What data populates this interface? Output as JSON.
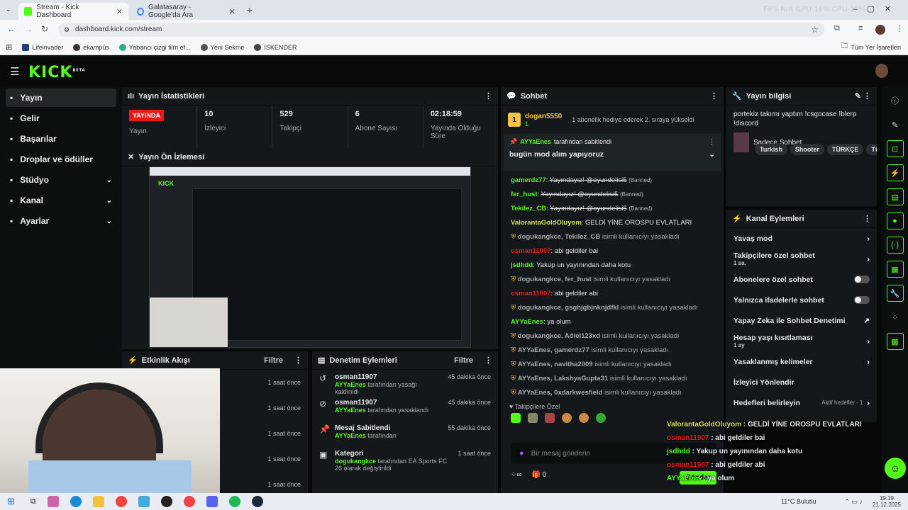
{
  "browser": {
    "tabs": [
      {
        "label": "Stream - Kick Dashboard",
        "active": true
      },
      {
        "label": "Galatasaray - Google'da Ara",
        "active": false
      }
    ],
    "perf": "FPS N/A   GPU 16%   CPU 19%",
    "url": "dashboard.kick.com/stream",
    "bookmarks": [
      "Lifeinvader",
      "ekampüs",
      "Yabancı çizgi film ef...",
      "Yeni Sekme",
      "İSKENDER"
    ],
    "all_bookmarks": "Tüm Yer İşaretleri"
  },
  "app": {
    "logo": "KICK",
    "logo_beta": "BETA",
    "sidebar": [
      {
        "label": "Yayın",
        "icon": "stream-icon",
        "active": true
      },
      {
        "label": "Gelir",
        "icon": "revenue-icon"
      },
      {
        "label": "Başarılar",
        "icon": "trophy-icon"
      },
      {
        "label": "Droplar ve ödüller",
        "icon": "gift-icon"
      },
      {
        "label": "Stüdyo",
        "icon": "studio-icon",
        "chevron": true
      },
      {
        "label": "Kanal",
        "icon": "channel-icon",
        "chevron": true
      },
      {
        "label": "Ayarlar",
        "icon": "gear-icon",
        "chevron": true
      }
    ]
  },
  "stats": {
    "title": "Yayın İstatistikleri",
    "items": [
      {
        "value": "YAYINDA",
        "label": "Yayın"
      },
      {
        "value": "10",
        "label": "İzleyici"
      },
      {
        "value": "529",
        "label": "Takipçi"
      },
      {
        "value": "6",
        "label": "Abone Sayısı"
      },
      {
        "value": "02:18:59",
        "label": "Yayında Olduğu Süre"
      }
    ]
  },
  "preview": {
    "title": "Yayın Ön İzlemesi"
  },
  "activity": {
    "title": "Etkinlik Akışı",
    "filter": "Filtre",
    "times": [
      "1 saat önce",
      "1 saat önce",
      "1 saat önce",
      "1 saat önce",
      "1 saat önce"
    ]
  },
  "moderation": {
    "title": "Denetim Eylemleri",
    "filter": "Filtre",
    "rows": [
      {
        "icon": "undo-icon",
        "title": "osman11907",
        "by": "AYYaEnes",
        "rest": "tarafından yasağı kaldırıldı",
        "time": "45 dakika önce"
      },
      {
        "icon": "ban-icon",
        "title": "osman11907",
        "by": "AYYaEnes",
        "rest": "tarafından yasaklandı",
        "time": "45 dakika önce"
      },
      {
        "icon": "pin-icon",
        "title": "Mesaj Sabitlendi",
        "by": "AYYaEnes",
        "rest": "tarafından",
        "time": "55 dakika önce"
      },
      {
        "icon": "category-icon",
        "title": "Kategori",
        "by": "dogukangkce",
        "rest": "tarafından EA Sports FC 26 olarak değiştirildi",
        "time": "1 saat önce"
      }
    ]
  },
  "chat": {
    "title": "Sohbet",
    "gifter": {
      "name": "dogan5550",
      "count": "1",
      "text": "1 abonelik hediye ederek 2. sıraya yükseldi"
    },
    "pinned": {
      "by": "AYYaEnes",
      "label": "tarafından sabitlendi",
      "text": "bugün mod alım yapıyoruz"
    },
    "messages": [
      {
        "user": "gamerdz77",
        "color": "#53fc18",
        "text": "Yayındayız! @oyundelisi5",
        "banned": "(Banned)"
      },
      {
        "user": "fer_hust",
        "color": "#53fc18",
        "text": "Yayındayız! @oyundelisi5",
        "banned": "(Banned)"
      },
      {
        "user": "Tekilez_CB",
        "color": "#53fc18",
        "text": "Yayındayız! @oyundelisi5",
        "banned": "(Banned)"
      },
      {
        "user": "ValorantaGoldOluyom",
        "color": "#d4e157",
        "text": "GELDİ YİNE OROSPU EVLATLARI"
      },
      {
        "sys": "dogukangkce, Tekilez_CB",
        "systext": "isimli kullanıcıyı yasakladı"
      },
      {
        "user": "osman11907",
        "color": "#e91916",
        "text": "abi geldiler bai"
      },
      {
        "user": "jsdhdd",
        "color": "#53fc18",
        "text": "Yakup un yayınından daha kotu"
      },
      {
        "sys": "dogukangkce, fer_hust",
        "systext": "isimli kullanıcıyı yasakladı"
      },
      {
        "user": "osman11907",
        "color": "#e91916",
        "text": "abi geldiler abi"
      },
      {
        "sys": "dogukangkce, gsghjgbjnknjdfkl",
        "systext": "isimli kullanıcıyı yasakladı"
      },
      {
        "user": "AYYaEnes",
        "color": "#53fc18",
        "text": "ya olum"
      },
      {
        "sys": "dogukangkce, Adiel123xd",
        "systext": "isimli kullanıcıyı yasakladı"
      },
      {
        "sys": "AYYaEnes, gamerdz77",
        "systext": "isimli kullanıcıyı yasakladı"
      },
      {
        "sys": "AYYaEnes, navitha2009",
        "systext": "isimli kullanıcıyı yasakladı"
      },
      {
        "sys": "AYYaEnes, LakshyaGupta31",
        "systext": "isimli kullanıcıyı yasakladı"
      },
      {
        "sys": "AYYaEnes, 0xdarkwesfield",
        "systext": "isimli kullanıcıyı yasakladı"
      }
    ],
    "followers_only": "Takipçilere Özel",
    "input_placeholder": "Bir mesaj gönderin",
    "points": "0",
    "send": "Gönder"
  },
  "overlay_chat": [
    {
      "user": "ValorantaGoldOluyom",
      "color": "#d4e157",
      "text": "GELDİ YİNE OROSPU EVLATLARI"
    },
    {
      "user": "osman11907",
      "color": "#e91916",
      "text": "abi geldiler bai"
    },
    {
      "user": "jsdhdd",
      "color": "#53fc18",
      "text": "Yakup un yayınından daha kotu"
    },
    {
      "user": "osman11907",
      "color": "#e91916",
      "text": "abi geldiler abi"
    },
    {
      "user": "AYYaEnes",
      "color": "#53fc18",
      "text": "ya olum"
    }
  ],
  "info": {
    "title": "Yayın bilgisi",
    "stream_title": "portekiz takımı yaptım !csgocase !blerp !discord",
    "category": "Sadece Sohbet",
    "tags": [
      "Turkish",
      "Shooter",
      "TÜRKÇE",
      "Türk"
    ]
  },
  "channel": {
    "title": "Kanal Eylemleri",
    "rows": [
      {
        "label": "Yavaş mod",
        "type": "chev"
      },
      {
        "label": "Takipçilere özel sohbet",
        "sub": "1 sa.",
        "type": "chev"
      },
      {
        "label": "Abonelere özel sohbet",
        "type": "toggle"
      },
      {
        "label": "Yalnızca ifadelerle sohbet",
        "type": "toggle"
      },
      {
        "label": "Yapay Zeka ile Sohbet Denetimi",
        "type": "ext"
      },
      {
        "label": "Hesap yaşı kısıtlaması",
        "sub": "1 ay",
        "type": "chev"
      },
      {
        "label": "Yasaklanmış kelimeler",
        "type": "chev"
      },
      {
        "label": "İzleyici Yönlendir",
        "type": "none"
      },
      {
        "label": "Hedefleri belirleyin",
        "extra": "Aktif hedefler - 1",
        "type": "chev"
      }
    ]
  },
  "taskbar": {
    "weather": "11°C  Bulutlu",
    "time": "19:19",
    "date": "21.12.2025"
  },
  "colors": {
    "accent": "#53fc18",
    "live": "#e91916",
    "panel": "#14181a"
  }
}
